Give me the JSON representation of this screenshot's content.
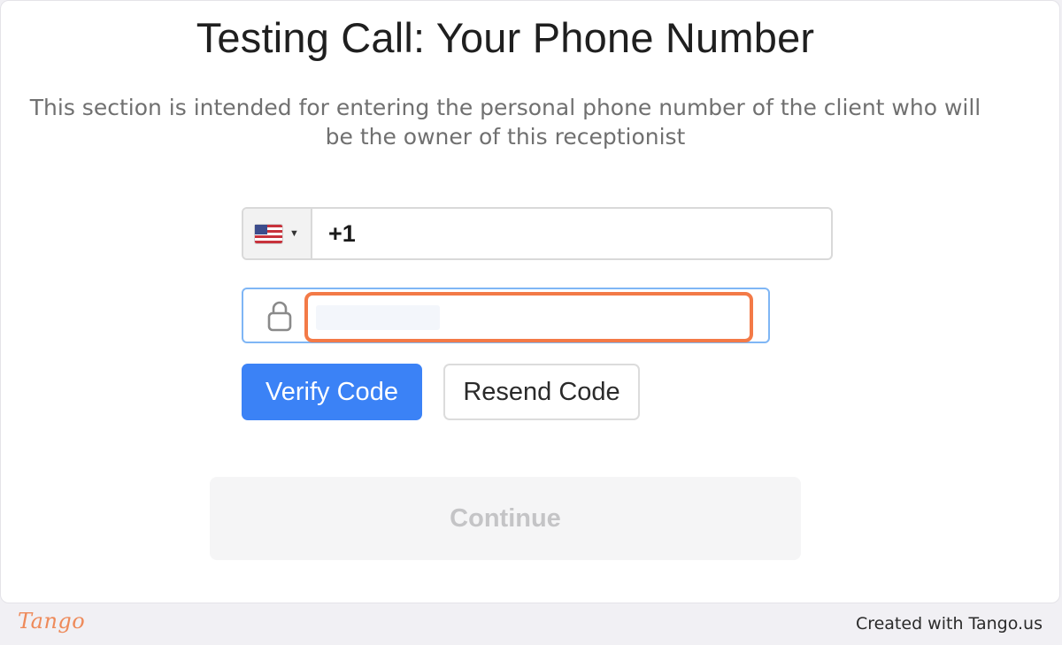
{
  "page": {
    "title": "Testing Call: Your Phone Number",
    "subtitle": "This section is intended for entering the personal phone number of the client who will be the owner of this receptionist"
  },
  "phone": {
    "country_icon": "us-flag-icon",
    "dropdown_icon": "caret-down-icon",
    "value": "+1"
  },
  "code": {
    "icon": "lock-icon",
    "value": ""
  },
  "buttons": {
    "verify": "Verify Code",
    "resend": "Resend Code",
    "continue": "Continue"
  },
  "footer": {
    "logo": "Tango",
    "credit": "Created with Tango.us"
  },
  "colors": {
    "primary": "#3b82f6",
    "highlight": "#f37a47",
    "focus_border": "#7fb6f5"
  }
}
